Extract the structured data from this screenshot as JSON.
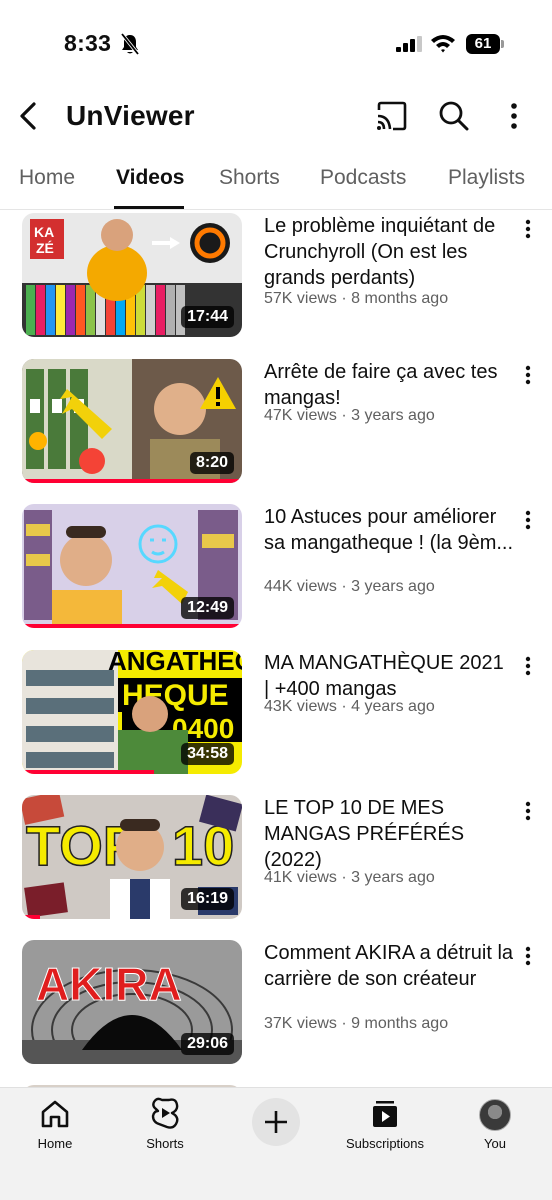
{
  "status_bar": {
    "time": "8:33",
    "battery": "61"
  },
  "header": {
    "title": "UnViewer"
  },
  "tabs": [
    {
      "label": "Home"
    },
    {
      "label": "Videos"
    },
    {
      "label": "Shorts"
    },
    {
      "label": "Podcasts"
    },
    {
      "label": "Playlists"
    }
  ],
  "active_tab": "Videos",
  "videos": [
    {
      "title": "Le problème inquiétant de Crunchyroll (On est les grands perdants)",
      "meta": "57K views · 8 months ago",
      "duration": "17:44",
      "watched_fraction": 0.0
    },
    {
      "title": "Arrête de faire ça avec tes mangas!",
      "meta": "47K views · 3 years ago",
      "duration": "8:20",
      "watched_fraction": 1.0
    },
    {
      "title": "10 Astuces pour améliorer sa mangatheque ! (la 9èm...",
      "meta": "44K views · 3 years ago",
      "duration": "12:49",
      "watched_fraction": 1.0
    },
    {
      "title": "MA MANGATHÈQUE 2021 | +400 mangas",
      "meta": "43K views · 4 years ago",
      "duration": "34:58",
      "watched_fraction": 0.6
    },
    {
      "title": "LE TOP 10 DE MES MANGAS PRÉFÉRÉS (2022)",
      "meta": "41K views · 3 years ago",
      "duration": "16:19",
      "watched_fraction": 0.08
    },
    {
      "title": "Comment AKIRA a détruit la carrière de son créateur",
      "meta": "37K views · 9 months ago",
      "duration": "29:06",
      "watched_fraction": 0.0
    }
  ],
  "bottom_nav": {
    "home": "Home",
    "shorts": "Shorts",
    "subscriptions": "Subscriptions",
    "you": "You"
  },
  "colors": {
    "accent": "#ff0033",
    "text": "#0f0f0f",
    "secondary_text": "#606060"
  }
}
